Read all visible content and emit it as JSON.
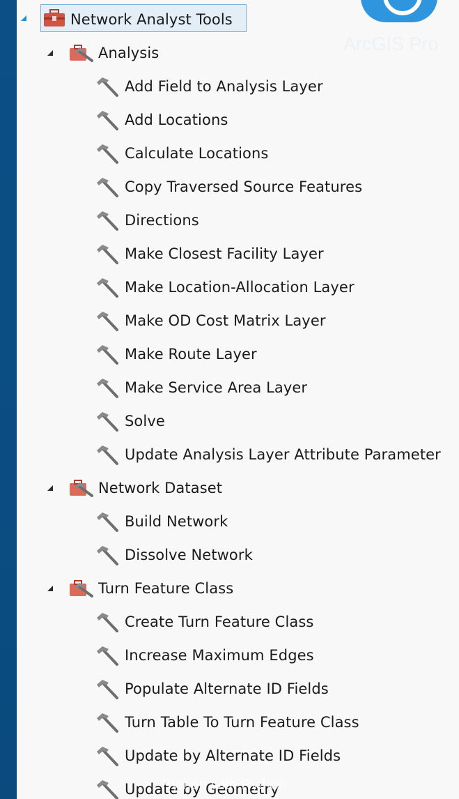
{
  "branding": {
    "product": "ArcGIS Pro",
    "watermark": "Python with Python"
  },
  "tree": {
    "root": {
      "label": "Network Analyst Tools",
      "expanded": true
    },
    "groups": [
      {
        "label": "Analysis",
        "expanded": true,
        "tools": [
          "Add Field to Analysis Layer",
          "Add Locations",
          "Calculate Locations",
          "Copy Traversed Source Features",
          "Directions",
          "Make Closest Facility Layer",
          "Make Location-Allocation Layer",
          "Make OD Cost Matrix Layer",
          "Make Route Layer",
          "Make Service Area Layer",
          "Solve",
          "Update Analysis Layer Attribute Parameter"
        ]
      },
      {
        "label": "Network Dataset",
        "expanded": true,
        "tools": [
          "Build Network",
          "Dissolve Network"
        ]
      },
      {
        "label": "Turn Feature Class",
        "expanded": true,
        "tools": [
          "Create Turn Feature Class",
          "Increase Maximum Edges",
          "Populate Alternate ID Fields",
          "Turn Table To Turn Feature Class",
          "Update by Alternate ID Fields",
          "Update by Geometry"
        ]
      }
    ]
  },
  "colors": {
    "background": "#0b4d82",
    "panel": "#f8f8f8",
    "selection": "#e4eef7",
    "toolbox": "#c0473a",
    "accent": "#2f95dd"
  }
}
